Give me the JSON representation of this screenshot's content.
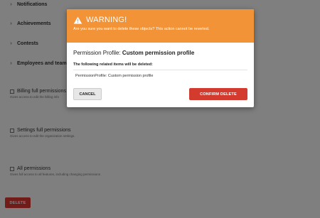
{
  "background": {
    "sections": [
      {
        "label": "Notifications"
      },
      {
        "label": "Achievements"
      },
      {
        "label": "Contests"
      },
      {
        "label": "Employees and teams"
      }
    ],
    "permissions": [
      {
        "label": "Billing full permissions",
        "description": "Gives access to edit the billing info"
      },
      {
        "label": "Settings full permissions",
        "description": "Gives access to edit the organization settings."
      },
      {
        "label": "All permissions",
        "description": "Gives full access to all features, including changing permissions"
      }
    ],
    "delete_label": "DELETE"
  },
  "modal": {
    "title": "WARNING!",
    "subtitle": "Are you sure you want to delete these objects? This action cannot be reverted.",
    "object_prefix": "Permission Profile:",
    "object_name": "Custom permission profile",
    "related_heading": "The following related items will be deleted:",
    "related_items": [
      "PermissionProfile: Custom permission profile"
    ],
    "cancel_label": "CANCEL",
    "confirm_label": "CONFIRM DELETE"
  },
  "colors": {
    "warning_header": "#f29337",
    "danger": "#d23b2e"
  }
}
